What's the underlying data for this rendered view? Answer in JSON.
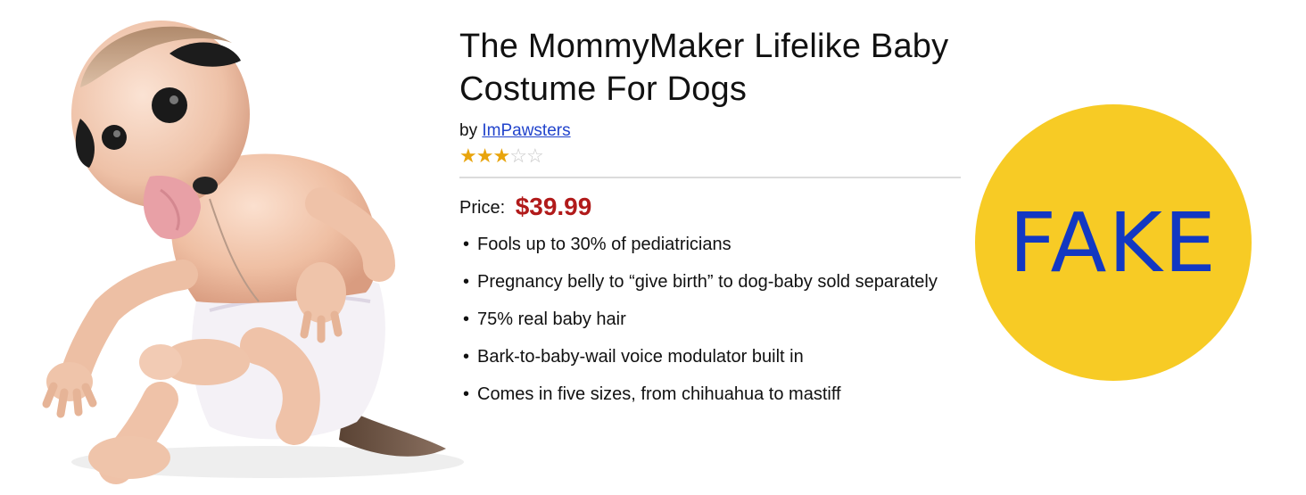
{
  "product": {
    "title": "The MommyMaker Lifelike Baby Costume For Dogs",
    "by_label": "by",
    "brand": "ImPawsters",
    "rating": 3,
    "rating_max": 5,
    "price_label": "Price:",
    "price": "$39.99",
    "features": [
      "Fools up to 30% of pediatricians",
      "Pregnancy belly to “give birth” to dog-baby sold separately",
      "75% real baby hair",
      "Bark-to-baby-wail voice modulator built in",
      "Comes in five sizes, from chihuahua to mastiff"
    ]
  },
  "badge": {
    "text": "FAKE",
    "background": "#f7cb25",
    "text_color": "#1238c2"
  },
  "colors": {
    "price": "#b11a1a",
    "link": "#2244cc",
    "star": "#e8a40c"
  },
  "image": {
    "icon": "baby-dog-costume-photo"
  }
}
